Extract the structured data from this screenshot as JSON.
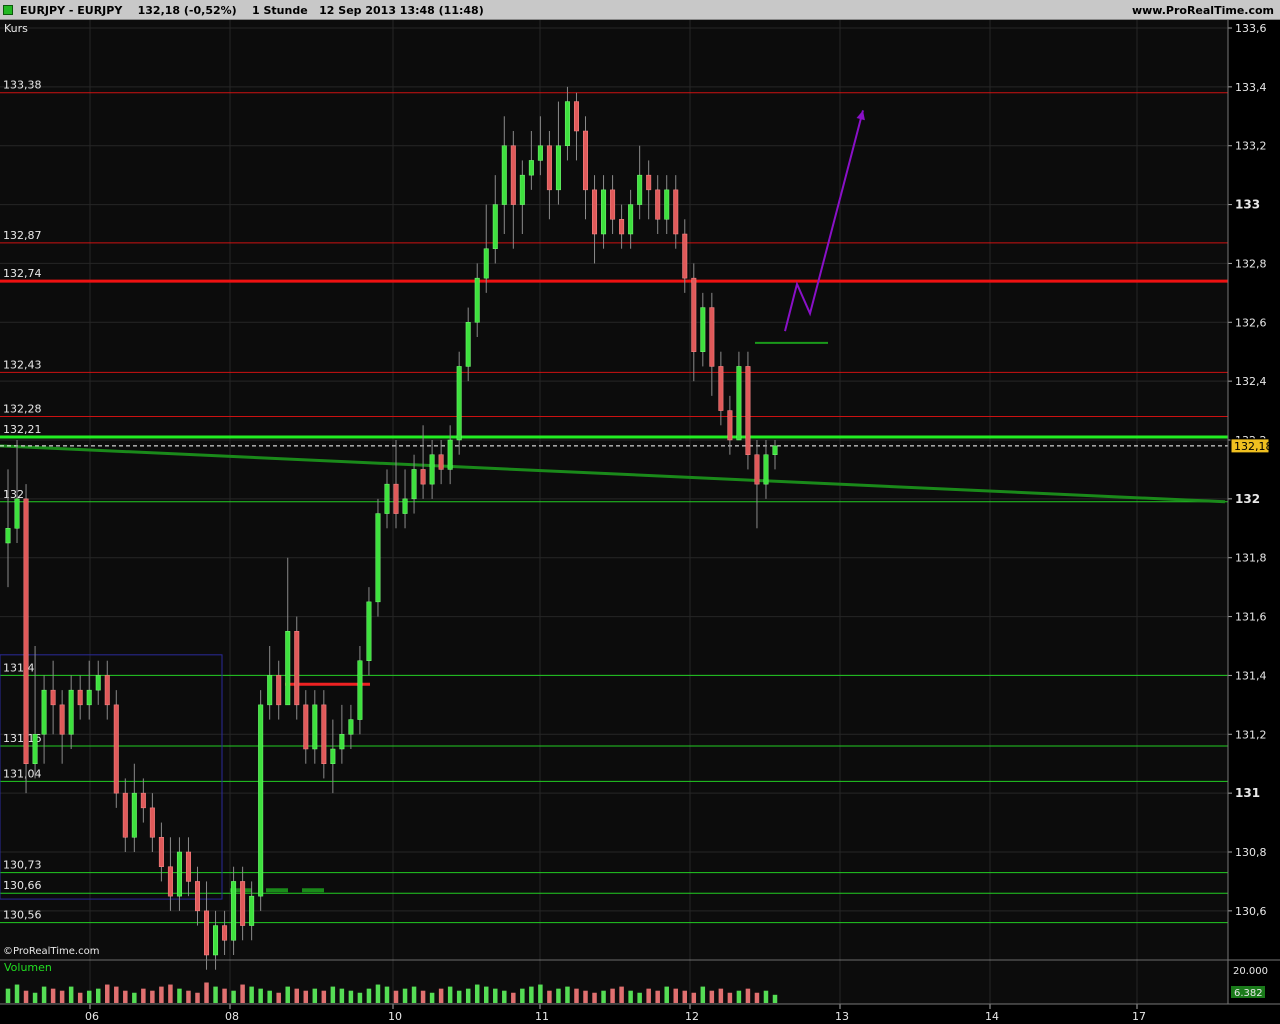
{
  "window": {
    "title": "EURJPY - EURJPY    132,18 (-0,52%)    1 Stunde   12 Sep 2013 13:48 (11:48)",
    "site": "www.ProRealTime.com"
  },
  "panels": {
    "price_label": "Kurs",
    "volume_label": "Volumen",
    "watermark": "©ProRealTime.com"
  },
  "chart_data": {
    "type": "candlestick",
    "instrument": "EURJPY",
    "last_price": 132.18,
    "last_price_label": "132,18",
    "change": "-0,52%",
    "timeframe": "1 Stunde",
    "ylim": [
      130.45,
      133.6
    ],
    "y_ticks": [
      {
        "v": 133.6,
        "label": "133,6"
      },
      {
        "v": 133.4,
        "label": "133,4"
      },
      {
        "v": 133.2,
        "label": "133,2"
      },
      {
        "v": 133.0,
        "label": "133",
        "bold": true
      },
      {
        "v": 132.8,
        "label": "132,8"
      },
      {
        "v": 132.6,
        "label": "132,6"
      },
      {
        "v": 132.4,
        "label": "132,4"
      },
      {
        "v": 132.2,
        "label": "132,2"
      },
      {
        "v": 132.0,
        "label": "132",
        "bold": true
      },
      {
        "v": 131.8,
        "label": "131,8"
      },
      {
        "v": 131.6,
        "label": "131,6"
      },
      {
        "v": 131.4,
        "label": "131,4"
      },
      {
        "v": 131.2,
        "label": "131,2"
      },
      {
        "v": 131.0,
        "label": "131",
        "bold": true
      },
      {
        "v": 130.8,
        "label": "130,8"
      },
      {
        "v": 130.6,
        "label": "130,6"
      }
    ],
    "x_ticks": [
      {
        "label": "06",
        "at": 85
      },
      {
        "label": "08",
        "at": 225
      },
      {
        "label": "10",
        "at": 388
      },
      {
        "label": "11",
        "at": 535
      },
      {
        "label": "12",
        "at": 685
      },
      {
        "label": "13",
        "at": 835
      },
      {
        "label": "14",
        "at": 985
      },
      {
        "label": "17",
        "at": 1132
      }
    ],
    "resistance_levels": [
      {
        "value": 133.38,
        "label": "133,38",
        "color": "#cc1111",
        "width": 1
      },
      {
        "value": 132.87,
        "label": "132,87",
        "color": "#cc1111",
        "width": 1
      },
      {
        "value": 132.74,
        "label": "132,74",
        "color": "#ee1111",
        "width": 3
      },
      {
        "value": 132.43,
        "label": "132,43",
        "color": "#cc1111",
        "width": 1
      },
      {
        "value": 132.28,
        "label": "132,28",
        "color": "#cc1111",
        "width": 1
      }
    ],
    "support_levels": [
      {
        "value": 132.21,
        "label": "132,21",
        "color": "#22ee22",
        "width": 3
      },
      {
        "value": 131.99,
        "label": "132",
        "color": "#22cc22",
        "width": 1
      },
      {
        "value": 131.4,
        "label": "131,4",
        "color": "#22cc22",
        "width": 1
      },
      {
        "value": 131.16,
        "label": "131,16",
        "color": "#22cc22",
        "width": 1
      },
      {
        "value": 131.04,
        "label": "131,04",
        "color": "#22cc22",
        "width": 1
      },
      {
        "value": 130.73,
        "label": "130,73",
        "color": "#22cc22",
        "width": 1
      },
      {
        "value": 130.66,
        "label": "130,66",
        "color": "#22cc22",
        "width": 1
      },
      {
        "value": 130.56,
        "label": "130,56",
        "color": "#22cc22",
        "width": 1
      }
    ],
    "candles": [
      [
        131.85,
        131.9,
        132.1,
        131.7
      ],
      [
        131.9,
        132.0,
        132.2,
        131.85
      ],
      [
        132.0,
        131.1,
        132.05,
        131.0
      ],
      [
        131.1,
        131.2,
        131.5,
        131.05
      ],
      [
        131.2,
        131.35,
        131.4,
        131.1
      ],
      [
        131.35,
        131.3,
        131.45,
        131.2
      ],
      [
        131.3,
        131.2,
        131.35,
        131.1
      ],
      [
        131.2,
        131.35,
        131.4,
        131.15
      ],
      [
        131.35,
        131.3,
        131.4,
        131.25
      ],
      [
        131.3,
        131.35,
        131.45,
        131.25
      ],
      [
        131.35,
        131.4,
        131.45,
        131.3
      ],
      [
        131.4,
        131.3,
        131.45,
        131.25
      ],
      [
        131.3,
        131.0,
        131.35,
        130.95
      ],
      [
        131.0,
        130.85,
        131.05,
        130.8
      ],
      [
        130.85,
        131.0,
        131.1,
        130.8
      ],
      [
        131.0,
        130.95,
        131.05,
        130.9
      ],
      [
        130.95,
        130.85,
        131.0,
        130.8
      ],
      [
        130.85,
        130.75,
        130.9,
        130.7
      ],
      [
        130.75,
        130.65,
        130.85,
        130.6
      ],
      [
        130.65,
        130.8,
        130.85,
        130.6
      ],
      [
        130.8,
        130.7,
        130.85,
        130.65
      ],
      [
        130.7,
        130.6,
        130.75,
        130.55
      ],
      [
        130.6,
        130.45,
        130.7,
        130.4
      ],
      [
        130.45,
        130.55,
        130.6,
        130.4
      ],
      [
        130.55,
        130.5,
        130.6,
        130.45
      ],
      [
        130.5,
        130.7,
        130.75,
        130.45
      ],
      [
        130.7,
        130.55,
        130.75,
        130.5
      ],
      [
        130.55,
        130.65,
        130.7,
        130.5
      ],
      [
        130.65,
        131.3,
        131.35,
        130.6
      ],
      [
        131.3,
        131.4,
        131.5,
        131.25
      ],
      [
        131.4,
        131.3,
        131.45,
        131.25
      ],
      [
        131.3,
        131.55,
        131.8,
        131.3
      ],
      [
        131.55,
        131.3,
        131.6,
        131.25
      ],
      [
        131.3,
        131.15,
        131.35,
        131.1
      ],
      [
        131.15,
        131.3,
        131.35,
        131.1
      ],
      [
        131.3,
        131.1,
        131.35,
        131.05
      ],
      [
        131.1,
        131.15,
        131.25,
        131.0
      ],
      [
        131.15,
        131.2,
        131.3,
        131.1
      ],
      [
        131.2,
        131.25,
        131.3,
        131.15
      ],
      [
        131.25,
        131.45,
        131.5,
        131.2
      ],
      [
        131.45,
        131.65,
        131.7,
        131.4
      ],
      [
        131.65,
        131.95,
        132.0,
        131.6
      ],
      [
        131.95,
        132.05,
        132.1,
        131.9
      ],
      [
        132.05,
        131.95,
        132.2,
        131.9
      ],
      [
        131.95,
        132.0,
        132.1,
        131.9
      ],
      [
        132.0,
        132.1,
        132.15,
        131.95
      ],
      [
        132.1,
        132.05,
        132.25,
        132.0
      ],
      [
        132.05,
        132.15,
        132.2,
        132.0
      ],
      [
        132.15,
        132.1,
        132.2,
        132.05
      ],
      [
        132.1,
        132.2,
        132.25,
        132.05
      ],
      [
        132.2,
        132.45,
        132.5,
        132.15
      ],
      [
        132.45,
        132.6,
        132.65,
        132.4
      ],
      [
        132.6,
        132.75,
        132.8,
        132.55
      ],
      [
        132.75,
        132.85,
        133.0,
        132.7
      ],
      [
        132.85,
        133.0,
        133.1,
        132.8
      ],
      [
        133.0,
        133.2,
        133.3,
        132.9
      ],
      [
        133.2,
        133.0,
        133.25,
        132.85
      ],
      [
        133.0,
        133.1,
        133.15,
        132.9
      ],
      [
        133.1,
        133.15,
        133.25,
        133.05
      ],
      [
        133.15,
        133.2,
        133.3,
        133.1
      ],
      [
        133.2,
        133.05,
        133.25,
        132.95
      ],
      [
        133.05,
        133.2,
        133.35,
        133.0
      ],
      [
        133.2,
        133.35,
        133.4,
        133.15
      ],
      [
        133.35,
        133.25,
        133.38,
        133.15
      ],
      [
        133.25,
        133.05,
        133.3,
        132.95
      ],
      [
        133.05,
        132.9,
        133.1,
        132.8
      ],
      [
        132.9,
        133.05,
        133.1,
        132.85
      ],
      [
        133.05,
        132.95,
        133.1,
        132.9
      ],
      [
        132.95,
        132.9,
        133.0,
        132.85
      ],
      [
        132.9,
        133.0,
        133.05,
        132.85
      ],
      [
        133.0,
        133.1,
        133.2,
        132.95
      ],
      [
        133.1,
        133.05,
        133.15,
        132.95
      ],
      [
        133.05,
        132.95,
        133.1,
        132.9
      ],
      [
        132.95,
        133.05,
        133.1,
        132.9
      ],
      [
        133.05,
        132.9,
        133.1,
        132.85
      ],
      [
        132.9,
        132.75,
        132.95,
        132.7
      ],
      [
        132.75,
        132.5,
        132.8,
        132.4
      ],
      [
        132.5,
        132.65,
        132.7,
        132.45
      ],
      [
        132.65,
        132.45,
        132.7,
        132.35
      ],
      [
        132.45,
        132.3,
        132.5,
        132.25
      ],
      [
        132.3,
        132.2,
        132.35,
        132.15
      ],
      [
        132.2,
        132.45,
        132.5,
        132.2
      ],
      [
        132.45,
        132.15,
        132.5,
        132.1
      ],
      [
        132.15,
        132.05,
        132.2,
        131.9
      ],
      [
        132.05,
        132.15,
        132.2,
        132.0
      ],
      [
        132.15,
        132.18,
        132.2,
        132.1
      ]
    ],
    "volume": [
      7,
      9,
      6,
      5,
      8,
      7,
      6,
      8,
      5,
      6,
      7,
      9,
      8,
      6,
      5,
      7,
      6,
      8,
      9,
      7,
      6,
      5,
      10,
      8,
      7,
      6,
      9,
      8,
      7,
      6,
      5,
      8,
      7,
      6,
      7,
      6,
      8,
      7,
      6,
      5,
      7,
      9,
      8,
      6,
      7,
      8,
      6,
      5,
      7,
      8,
      6,
      7,
      9,
      8,
      7,
      6,
      5,
      7,
      8,
      9,
      6,
      7,
      8,
      7,
      6,
      5,
      6,
      7,
      8,
      6,
      5,
      7,
      6,
      8,
      7,
      6,
      5,
      8,
      6,
      7,
      5,
      6,
      7,
      5,
      6,
      4
    ],
    "volume_ylim": [
      0,
      20000
    ],
    "volume_ticks": [
      {
        "v": 20000,
        "label": "20.000"
      }
    ],
    "volume_last_label": "6.382",
    "annotations": {
      "trendline": {
        "from": {
          "x": 0,
          "y": 132.18
        },
        "to": {
          "x": 1225,
          "y": 131.99
        },
        "color": "#1a8a1a"
      },
      "short_green": {
        "x1": 755,
        "x2": 828,
        "y": 132.53,
        "color": "#1a9a1a"
      },
      "red_box_level": {
        "x1": 285,
        "x2": 370,
        "y": 131.37,
        "color": "#ee2222"
      },
      "green_dashes": {
        "x1": 230,
        "x2": 325,
        "y": 130.67,
        "color": "#1a8a1a"
      },
      "blue_box": {
        "x1": 0,
        "x2": 222,
        "y_top": 131.47,
        "y_bot": 130.64,
        "color": "#2a2a9a"
      },
      "forecast_path": [
        [
          785,
          132.57
        ],
        [
          797,
          132.73
        ],
        [
          810,
          132.63
        ],
        [
          863,
          133.32
        ]
      ],
      "forecast_color": "#8a10c8"
    }
  }
}
